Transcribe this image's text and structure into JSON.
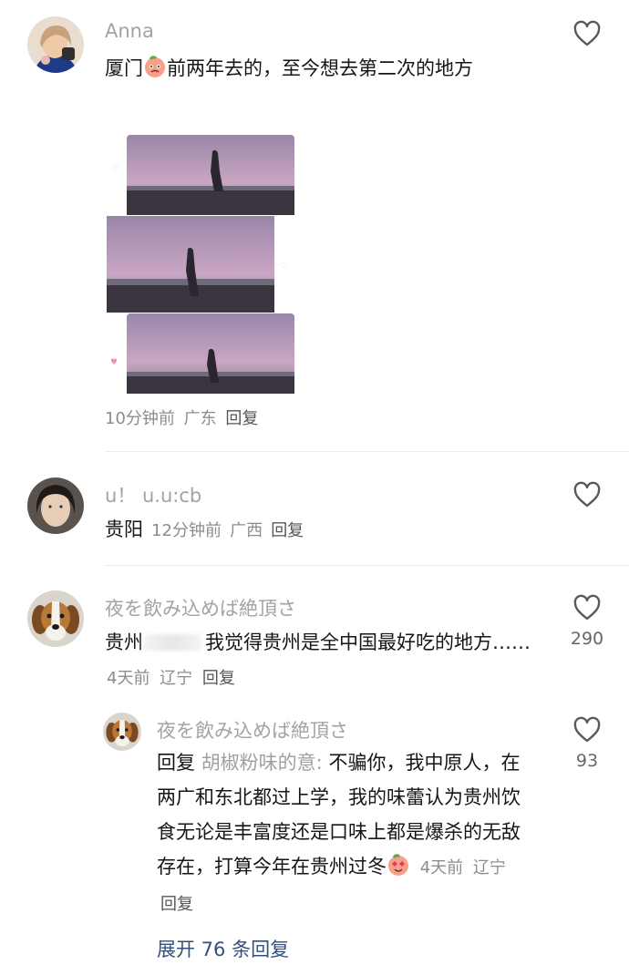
{
  "comments": [
    {
      "username": "Anna",
      "text_before_sticker": "厦门",
      "text_after_sticker": "前两年去的，至今想去第二次的地方",
      "meta": {
        "time": "10分钟前",
        "location": "广东",
        "reply": "回复"
      },
      "sticker_icon": "peach-face-sticker"
    },
    {
      "username": "u！ u.u:cb",
      "text": "贵阳",
      "meta": {
        "time": "12分钟前",
        "location": "广西",
        "reply": "回复"
      }
    },
    {
      "username": "夜を飲み込めば絶頂さ",
      "text_prefix": "贵州",
      "text": "我觉得贵州是全中国最好吃的地方……",
      "meta": {
        "time": "4天前",
        "location": "辽宁",
        "reply": "回复"
      },
      "like_count": "290",
      "replies": [
        {
          "username": "夜を飲み込めば絶頂さ",
          "reply_prefix": "回复",
          "mention": "胡椒粉味的意:",
          "text": "不骗你，我中原人，在两广和东北都过上学，我的味蕾认为贵州饮食无论是丰富度还是口味上都是爆杀的无敌存在，打算今年在贵州过冬",
          "sticker_icon": "peach-heart-eyes-sticker",
          "meta": {
            "time": "4天前",
            "location": "辽宁",
            "reply": "回复"
          },
          "like_count": "93"
        }
      ],
      "expand_label": "展开 76 条回复"
    }
  ],
  "colors": {
    "username": "#a3a3a3",
    "body_text": "#161616",
    "link_blue": "#33507d",
    "divider": "#ececec"
  },
  "icons": [
    "heart-outline-icon",
    "peach-face-sticker",
    "peach-heart-eyes-sticker"
  ]
}
